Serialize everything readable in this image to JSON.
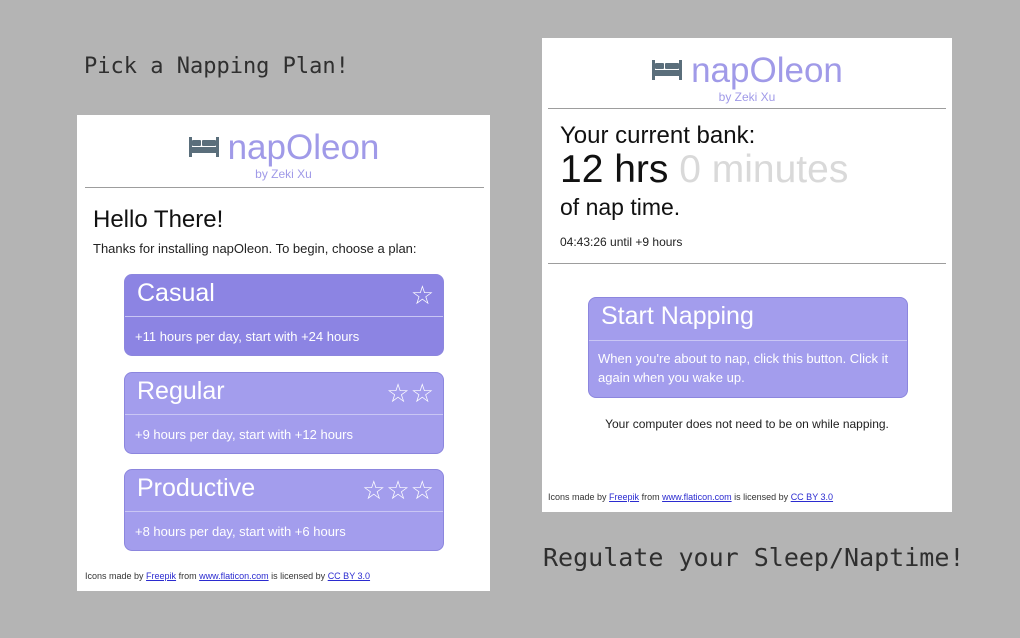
{
  "captions": {
    "left": "Pick a Napping Plan!",
    "right": "Regulate your Sleep/Naptime!"
  },
  "brand": {
    "title": "napOleon",
    "subtitle": "by Zeki Xu",
    "icon": "bed-icon",
    "color": "#a09ae8"
  },
  "plan_screen": {
    "greeting": "Hello There!",
    "intro": "Thanks for installing napOleon. To begin, choose a plan:",
    "plans": [
      {
        "name": "Casual",
        "stars": "☆",
        "description": "+11 hours per day, start with +24 hours"
      },
      {
        "name": "Regular",
        "stars": "☆☆",
        "description": "+9 hours per day, start with +12 hours"
      },
      {
        "name": "Productive",
        "stars": "☆☆☆",
        "description": "+8 hours per day, start with +6 hours"
      }
    ]
  },
  "bank_screen": {
    "bank_label": "Your current bank:",
    "hours": "12 hrs",
    "minutes": "0 minutes",
    "suffix": "of nap time.",
    "countdown": "04:43:26 until +9 hours",
    "start_button": {
      "title": "Start Napping",
      "description": "When you're about to nap, click this button. Click it again when you wake up."
    },
    "note": "Your computer does not need to be on while napping."
  },
  "credits": {
    "prefix": "Icons made by",
    "author": "Freepik",
    "from": "from",
    "site": "www.flaticon.com",
    "license_text": "is licensed by",
    "license": "CC BY 3.0"
  },
  "colors": {
    "accent": "#a39ded",
    "accent_selected": "#8c84e3",
    "background": "#b4b4b4",
    "minutes_faded": "#d9d9d9"
  }
}
